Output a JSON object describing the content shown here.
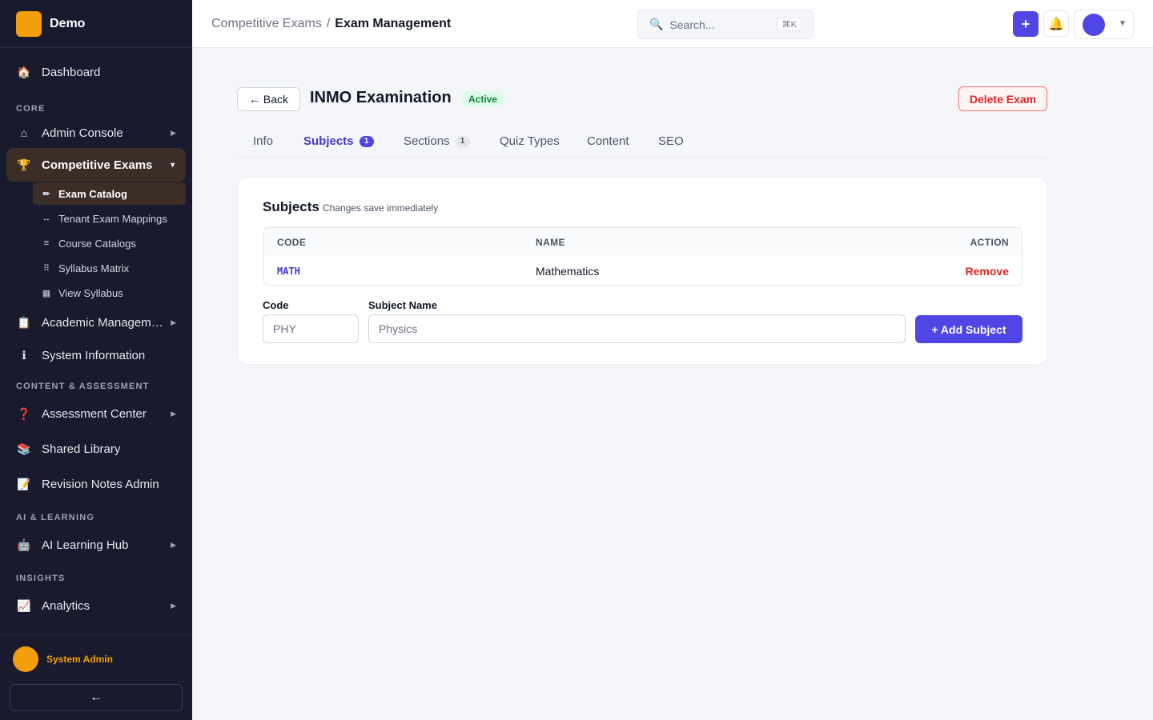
{
  "app": {
    "name": "Demo"
  },
  "sidebar": {
    "items": {
      "dashboard": {
        "label": "Dashboard",
        "icon": "🏠"
      },
      "admin_console": {
        "label": "Admin Console",
        "icon": "⌂"
      },
      "competitive_exams": {
        "label": "Competitive Exams",
        "icon": "🏆"
      },
      "academic_management": {
        "label": "Academic Management",
        "icon": "📋"
      },
      "system_information": {
        "label": "System Information",
        "icon": "ℹ"
      },
      "assessment_center": {
        "label": "Assessment Center",
        "icon": "❓"
      },
      "shared_library": {
        "label": "Shared Library",
        "icon": "📚"
      },
      "revision_notes_admin": {
        "label": "Revision Notes Admin",
        "icon": "📝"
      },
      "ai_learning_hub": {
        "label": "AI Learning Hub",
        "icon": "🤖"
      },
      "analytics": {
        "label": "Analytics",
        "icon": "📈"
      }
    },
    "sections": {
      "core": "CORE",
      "content_assessment": "CONTENT & ASSESSMENT",
      "ai_learning": "AI & LEARNING",
      "insights": "INSIGHTS"
    },
    "sub_items": {
      "exam_catalog": {
        "label": "Exam Catalog",
        "icon": "✏"
      },
      "tenant_exam_mappings": {
        "label": "Tenant Exam Mappings",
        "icon": "↔"
      },
      "course_catalogs": {
        "label": "Course Catalogs",
        "icon": "≡"
      },
      "syllabus_matrix": {
        "label": "Syllabus Matrix",
        "icon": "⠿"
      },
      "view_syllabus": {
        "label": "View Syllabus",
        "icon": "▦"
      }
    },
    "user": {
      "name": "System Admin"
    },
    "collapse_icon": "←"
  },
  "topbar": {
    "breadcrumb": {
      "parent": "Competitive Exams",
      "separator": "/",
      "current": "Exam Management"
    },
    "search": {
      "placeholder": "Search...",
      "shortcut": "⌘K",
      "icon": "🔍"
    },
    "plus_icon": "+",
    "bell_icon": "🔔",
    "user_caret": "▼"
  },
  "page": {
    "back_label": "← Back",
    "title": "INMO Examination",
    "status": "Active",
    "delete_label": "Delete Exam"
  },
  "tabs": [
    {
      "label": "Info",
      "count": null
    },
    {
      "label": "Subjects",
      "count": "1"
    },
    {
      "label": "Sections",
      "count": "1"
    },
    {
      "label": "Quiz Types",
      "count": null
    },
    {
      "label": "Content",
      "count": null
    },
    {
      "label": "SEO",
      "count": null
    }
  ],
  "subjects_card": {
    "title": "Subjects",
    "subtitle": "Changes save immediately",
    "columns": {
      "code": "CODE",
      "name": "NAME",
      "action": "ACTION"
    },
    "rows": [
      {
        "code": "MATH",
        "name": "Mathematics",
        "action": "Remove"
      }
    ],
    "form": {
      "code_label": "Code",
      "code_placeholder": "PHY",
      "name_label": "Subject Name",
      "name_placeholder": "Physics",
      "add_label": "+ Add Subject"
    }
  },
  "colors": {
    "accent": "#4f46e5",
    "sidebar_bg": "#1a1a2e",
    "brand": "#f59e0b",
    "danger": "#dc2626",
    "success": "#15803d"
  }
}
